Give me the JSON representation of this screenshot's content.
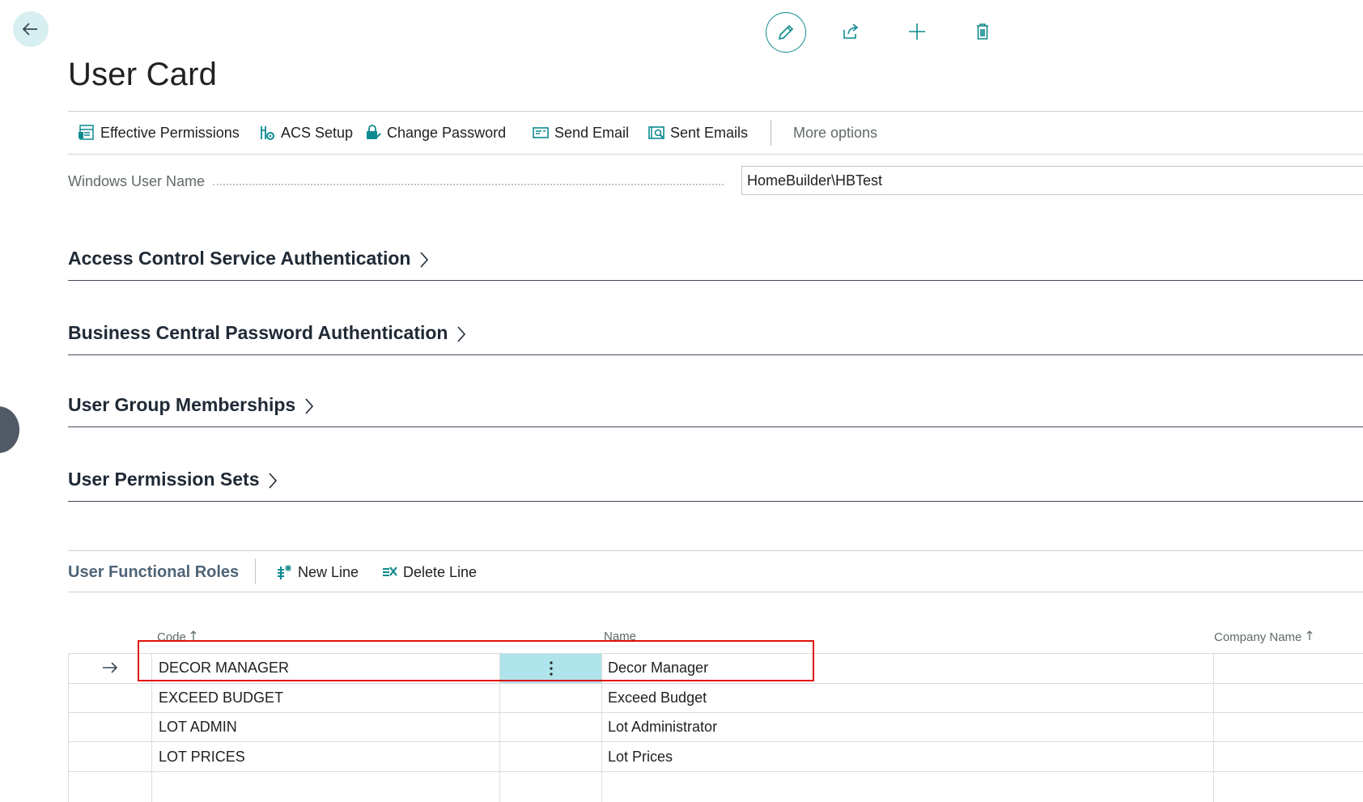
{
  "page": {
    "title": "User Card"
  },
  "actions": [
    {
      "label": "Effective Permissions",
      "icon": "effective-permissions-icon"
    },
    {
      "label": "ACS Setup",
      "icon": "acs-setup-icon"
    },
    {
      "label": "Change Password",
      "icon": "change-password-icon"
    },
    {
      "label": "Send Email",
      "icon": "send-email-icon"
    },
    {
      "label": "Sent Emails",
      "icon": "sent-emails-icon"
    }
  ],
  "more_options": "More options",
  "field": {
    "label": "Windows User Name",
    "value": "HomeBuilder\\HBTest"
  },
  "sections": [
    "Access Control Service Authentication",
    "Business Central Password Authentication",
    "User Group Memberships",
    "User Permission Sets"
  ],
  "subpage": {
    "title": "User Functional Roles",
    "new_line": "New Line",
    "delete_line": "Delete Line",
    "columns": {
      "code": "Code",
      "name": "Name",
      "company": "Company Name"
    },
    "rows": [
      {
        "code": "DECOR MANAGER",
        "name": "Decor Manager",
        "company": ""
      },
      {
        "code": "EXCEED BUDGET",
        "name": "Exceed Budget",
        "company": ""
      },
      {
        "code": "LOT ADMIN",
        "name": "Lot Administrator",
        "company": ""
      },
      {
        "code": "LOT PRICES",
        "name": "Lot Prices",
        "company": ""
      }
    ]
  },
  "colors": {
    "accent": "#0d8a8f",
    "highlight": "#e01010",
    "selected_cell": "#aee4ea"
  }
}
